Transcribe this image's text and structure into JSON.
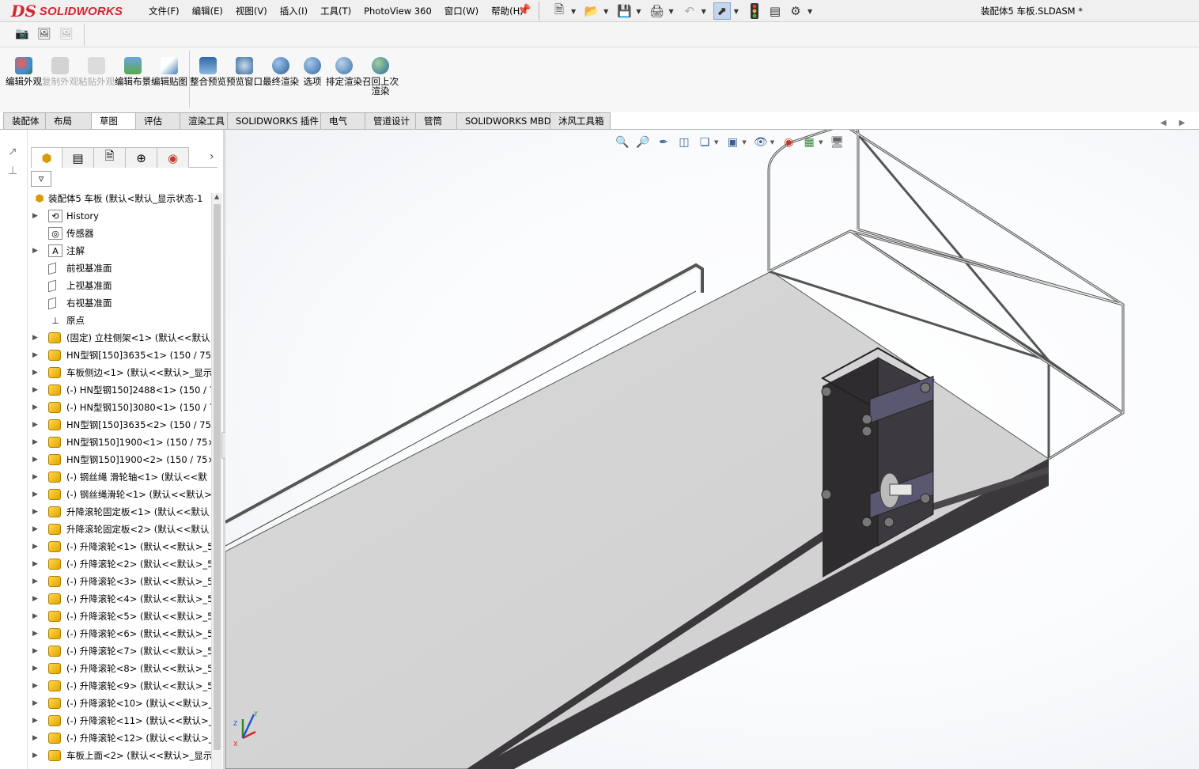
{
  "app": {
    "logo_ds": "DS",
    "logo_text": "SOLIDWORKS",
    "document_title": "装配体5 车板.SLDASM *"
  },
  "menus": [
    "文件(F)",
    "编辑(E)",
    "视图(V)",
    "插入(I)",
    "工具(T)",
    "PhotoView 360",
    "窗口(W)",
    "帮助(H)"
  ],
  "quick_access": {
    "new": "new-document-icon",
    "open": "open-icon",
    "save": "save-icon",
    "print": "print-icon",
    "undo": "undo-icon",
    "select": "select-pointer-icon",
    "rebuild": "traffic-light-icon",
    "file_props": "file-properties-icon",
    "options": "gear-icon"
  },
  "ribbon": {
    "buttons": [
      {
        "label": "编辑外观",
        "enabled": true,
        "color": "#3d8fd6"
      },
      {
        "label": "复制外观",
        "enabled": false,
        "color": "#c9c9c9"
      },
      {
        "label": "粘贴外观",
        "enabled": false,
        "color": "#d0d0d0"
      },
      {
        "label": "编辑布景",
        "enabled": true,
        "color": "#5aa84a"
      },
      {
        "label": "编辑贴图",
        "enabled": true,
        "color": "#4b7fb8"
      },
      {
        "label": "整合预览",
        "enabled": true,
        "color": "#2d6aa8"
      },
      {
        "label": "预览窗口",
        "enabled": true,
        "color": "#3a6ea0"
      },
      {
        "label": "最终渲染",
        "enabled": true,
        "color": "#2a5d96"
      },
      {
        "label": "选项",
        "enabled": true,
        "color": "#2f69a8"
      },
      {
        "label": "排定渲染",
        "enabled": true,
        "color": "#3a72a8"
      },
      {
        "label": "召回上次渲染",
        "enabled": true,
        "color": "#2f6a9e"
      }
    ]
  },
  "tabs": [
    {
      "label": "装配体",
      "active": false
    },
    {
      "label": "布局",
      "active": false
    },
    {
      "label": "草图",
      "active": true
    },
    {
      "label": "评估",
      "active": false
    },
    {
      "label": "渲染工具",
      "active": false
    },
    {
      "label": "SOLIDWORKS 插件",
      "active": false
    },
    {
      "label": "电气",
      "active": false
    },
    {
      "label": "管道设计",
      "active": false
    },
    {
      "label": "管筒",
      "active": false
    },
    {
      "label": "SOLIDWORKS MBD",
      "active": false
    },
    {
      "label": "沐风工具箱",
      "active": false
    }
  ],
  "tree": {
    "root": "装配体5 车板  (默认<默认_显示状态-1",
    "items": [
      {
        "label": "History",
        "icon": "history",
        "expandable": true
      },
      {
        "label": "传感器",
        "icon": "sensor",
        "expandable": false
      },
      {
        "label": "注解",
        "icon": "annotation",
        "expandable": true
      },
      {
        "label": "前视基准面",
        "icon": "plane",
        "expandable": false
      },
      {
        "label": "上视基准面",
        "icon": "plane",
        "expandable": false
      },
      {
        "label": "右视基准面",
        "icon": "plane",
        "expandable": false
      },
      {
        "label": "原点",
        "icon": "origin",
        "expandable": false
      },
      {
        "label": "(固定) 立柱侧架<1> (默认<<默认",
        "icon": "part",
        "expandable": true
      },
      {
        "label": "HN型钢[150]3635<1> (150 / 75",
        "icon": "part",
        "expandable": true
      },
      {
        "label": "车板侧边<1> (默认<<默认>_显示",
        "icon": "part",
        "expandable": true
      },
      {
        "label": "(-) HN型钢150]2488<1> (150 / 7",
        "icon": "part",
        "expandable": true
      },
      {
        "label": "(-) HN型钢150]3080<1> (150 / 7",
        "icon": "part",
        "expandable": true
      },
      {
        "label": "HN型钢[150]3635<2> (150 / 75",
        "icon": "part",
        "expandable": true
      },
      {
        "label": "HN型钢150]1900<1> (150 / 75×",
        "icon": "part",
        "expandable": true
      },
      {
        "label": "HN型钢150]1900<2> (150 / 75×",
        "icon": "part",
        "expandable": true
      },
      {
        "label": "(-) 钢丝绳 滑轮轴<1> (默认<<默",
        "icon": "part",
        "expandable": true
      },
      {
        "label": "(-) 钢丝绳滑轮<1> (默认<<默认>",
        "icon": "part",
        "expandable": true
      },
      {
        "label": "升降滚轮固定板<1> (默认<<默认",
        "icon": "part",
        "expandable": true
      },
      {
        "label": "升降滚轮固定板<2> (默认<<默认",
        "icon": "part",
        "expandable": true
      },
      {
        "label": "(-) 升降滚轮<1> (默认<<默认>_5",
        "icon": "part",
        "expandable": true
      },
      {
        "label": "(-) 升降滚轮<2> (默认<<默认>_5",
        "icon": "part",
        "expandable": true
      },
      {
        "label": "(-) 升降滚轮<3> (默认<<默认>_5",
        "icon": "part",
        "expandable": true
      },
      {
        "label": "(-) 升降滚轮<4> (默认<<默认>_5",
        "icon": "part",
        "expandable": true
      },
      {
        "label": "(-) 升降滚轮<5> (默认<<默认>_5",
        "icon": "part",
        "expandable": true
      },
      {
        "label": "(-) 升降滚轮<6> (默认<<默认>_5",
        "icon": "part",
        "expandable": true
      },
      {
        "label": "(-) 升降滚轮<7> (默认<<默认>_5",
        "icon": "part",
        "expandable": true
      },
      {
        "label": "(-) 升降滚轮<8> (默认<<默认>_5",
        "icon": "part",
        "expandable": true
      },
      {
        "label": "(-) 升降滚轮<9> (默认<<默认>_5",
        "icon": "part",
        "expandable": true
      },
      {
        "label": "(-) 升降滚轮<10> (默认<<默认>_",
        "icon": "part",
        "expandable": true
      },
      {
        "label": "(-) 升降滚轮<11> (默认<<默认>_",
        "icon": "part",
        "expandable": true
      },
      {
        "label": "(-) 升降滚轮<12> (默认<<默认>_",
        "icon": "part",
        "expandable": true
      },
      {
        "label": "车板上面<2> (默认<<默认>_显示",
        "icon": "part",
        "expandable": true
      }
    ]
  },
  "viewport": {
    "triad_x": "X",
    "triad_y": "Y",
    "triad_z": "Z"
  },
  "colors": {
    "brand_red": "#d22630",
    "platform_gray": "#d3d3d3",
    "steel_dark": "#3a383a"
  }
}
